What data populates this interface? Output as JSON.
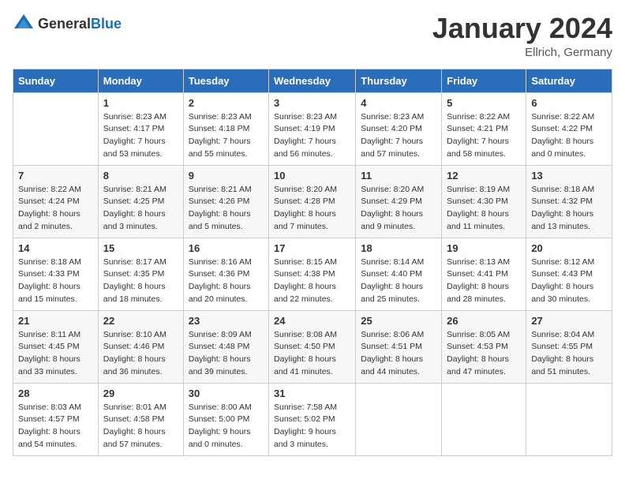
{
  "header": {
    "logo_general": "General",
    "logo_blue": "Blue",
    "month_year": "January 2024",
    "location": "Ellrich, Germany"
  },
  "days_of_week": [
    "Sunday",
    "Monday",
    "Tuesday",
    "Wednesday",
    "Thursday",
    "Friday",
    "Saturday"
  ],
  "weeks": [
    {
      "days": [
        {
          "number": "",
          "info": ""
        },
        {
          "number": "1",
          "info": "Sunrise: 8:23 AM\nSunset: 4:17 PM\nDaylight: 7 hours\nand 53 minutes."
        },
        {
          "number": "2",
          "info": "Sunrise: 8:23 AM\nSunset: 4:18 PM\nDaylight: 7 hours\nand 55 minutes."
        },
        {
          "number": "3",
          "info": "Sunrise: 8:23 AM\nSunset: 4:19 PM\nDaylight: 7 hours\nand 56 minutes."
        },
        {
          "number": "4",
          "info": "Sunrise: 8:23 AM\nSunset: 4:20 PM\nDaylight: 7 hours\nand 57 minutes."
        },
        {
          "number": "5",
          "info": "Sunrise: 8:22 AM\nSunset: 4:21 PM\nDaylight: 7 hours\nand 58 minutes."
        },
        {
          "number": "6",
          "info": "Sunrise: 8:22 AM\nSunset: 4:22 PM\nDaylight: 8 hours\nand 0 minutes."
        }
      ]
    },
    {
      "days": [
        {
          "number": "7",
          "info": "Sunrise: 8:22 AM\nSunset: 4:24 PM\nDaylight: 8 hours\nand 2 minutes."
        },
        {
          "number": "8",
          "info": "Sunrise: 8:21 AM\nSunset: 4:25 PM\nDaylight: 8 hours\nand 3 minutes."
        },
        {
          "number": "9",
          "info": "Sunrise: 8:21 AM\nSunset: 4:26 PM\nDaylight: 8 hours\nand 5 minutes."
        },
        {
          "number": "10",
          "info": "Sunrise: 8:20 AM\nSunset: 4:28 PM\nDaylight: 8 hours\nand 7 minutes."
        },
        {
          "number": "11",
          "info": "Sunrise: 8:20 AM\nSunset: 4:29 PM\nDaylight: 8 hours\nand 9 minutes."
        },
        {
          "number": "12",
          "info": "Sunrise: 8:19 AM\nSunset: 4:30 PM\nDaylight: 8 hours\nand 11 minutes."
        },
        {
          "number": "13",
          "info": "Sunrise: 8:18 AM\nSunset: 4:32 PM\nDaylight: 8 hours\nand 13 minutes."
        }
      ]
    },
    {
      "days": [
        {
          "number": "14",
          "info": "Sunrise: 8:18 AM\nSunset: 4:33 PM\nDaylight: 8 hours\nand 15 minutes."
        },
        {
          "number": "15",
          "info": "Sunrise: 8:17 AM\nSunset: 4:35 PM\nDaylight: 8 hours\nand 18 minutes."
        },
        {
          "number": "16",
          "info": "Sunrise: 8:16 AM\nSunset: 4:36 PM\nDaylight: 8 hours\nand 20 minutes."
        },
        {
          "number": "17",
          "info": "Sunrise: 8:15 AM\nSunset: 4:38 PM\nDaylight: 8 hours\nand 22 minutes."
        },
        {
          "number": "18",
          "info": "Sunrise: 8:14 AM\nSunset: 4:40 PM\nDaylight: 8 hours\nand 25 minutes."
        },
        {
          "number": "19",
          "info": "Sunrise: 8:13 AM\nSunset: 4:41 PM\nDaylight: 8 hours\nand 28 minutes."
        },
        {
          "number": "20",
          "info": "Sunrise: 8:12 AM\nSunset: 4:43 PM\nDaylight: 8 hours\nand 30 minutes."
        }
      ]
    },
    {
      "days": [
        {
          "number": "21",
          "info": "Sunrise: 8:11 AM\nSunset: 4:45 PM\nDaylight: 8 hours\nand 33 minutes."
        },
        {
          "number": "22",
          "info": "Sunrise: 8:10 AM\nSunset: 4:46 PM\nDaylight: 8 hours\nand 36 minutes."
        },
        {
          "number": "23",
          "info": "Sunrise: 8:09 AM\nSunset: 4:48 PM\nDaylight: 8 hours\nand 39 minutes."
        },
        {
          "number": "24",
          "info": "Sunrise: 8:08 AM\nSunset: 4:50 PM\nDaylight: 8 hours\nand 41 minutes."
        },
        {
          "number": "25",
          "info": "Sunrise: 8:06 AM\nSunset: 4:51 PM\nDaylight: 8 hours\nand 44 minutes."
        },
        {
          "number": "26",
          "info": "Sunrise: 8:05 AM\nSunset: 4:53 PM\nDaylight: 8 hours\nand 47 minutes."
        },
        {
          "number": "27",
          "info": "Sunrise: 8:04 AM\nSunset: 4:55 PM\nDaylight: 8 hours\nand 51 minutes."
        }
      ]
    },
    {
      "days": [
        {
          "number": "28",
          "info": "Sunrise: 8:03 AM\nSunset: 4:57 PM\nDaylight: 8 hours\nand 54 minutes."
        },
        {
          "number": "29",
          "info": "Sunrise: 8:01 AM\nSunset: 4:58 PM\nDaylight: 8 hours\nand 57 minutes."
        },
        {
          "number": "30",
          "info": "Sunrise: 8:00 AM\nSunset: 5:00 PM\nDaylight: 9 hours\nand 0 minutes."
        },
        {
          "number": "31",
          "info": "Sunrise: 7:58 AM\nSunset: 5:02 PM\nDaylight: 9 hours\nand 3 minutes."
        },
        {
          "number": "",
          "info": ""
        },
        {
          "number": "",
          "info": ""
        },
        {
          "number": "",
          "info": ""
        }
      ]
    }
  ]
}
